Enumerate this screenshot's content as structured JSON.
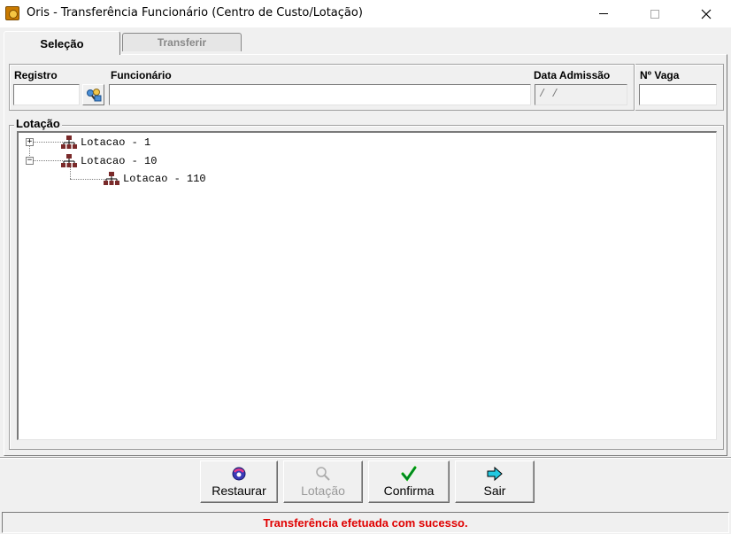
{
  "window": {
    "title": "Oris - Transferência Funcionário (Centro de Custo/Lotação)",
    "controls": [
      "minimize",
      "maximize",
      "close"
    ]
  },
  "tabs": [
    {
      "label": "Seleção",
      "active": true
    },
    {
      "label": "Transferir",
      "active": false
    }
  ],
  "fields": {
    "registro": {
      "label": "Registro",
      "value": ""
    },
    "funcionario": {
      "label": "Funcionário",
      "value": ""
    },
    "data_admissao": {
      "label": "Data Admissão",
      "value": " / /"
    },
    "n_vaga": {
      "label": "Nº Vaga",
      "value": ""
    }
  },
  "lotacao": {
    "label": "Lotação",
    "tree": [
      {
        "label": "Lotacao - 1",
        "expander": "+",
        "level": 0
      },
      {
        "label": "Lotacao - 10",
        "expander": "−",
        "level": 0
      },
      {
        "label": "Lotacao - 110",
        "expander": null,
        "level": 1
      }
    ]
  },
  "buttons": {
    "restaurar": "Restaurar",
    "lotacao": "Lotação",
    "confirma": "Confirma",
    "sair": "Sair"
  },
  "status": {
    "message": "Transferência efetuada com sucesso.",
    "color": "#e00000"
  },
  "icons": {
    "app": "oris-app-icon",
    "search": "people-search-icon",
    "tree_node": "org-chart-icon",
    "restaurar": "restore-icon",
    "lotacao": "magnifier-icon",
    "confirma": "checkmark-icon",
    "sair": "exit-arrow-icon"
  }
}
